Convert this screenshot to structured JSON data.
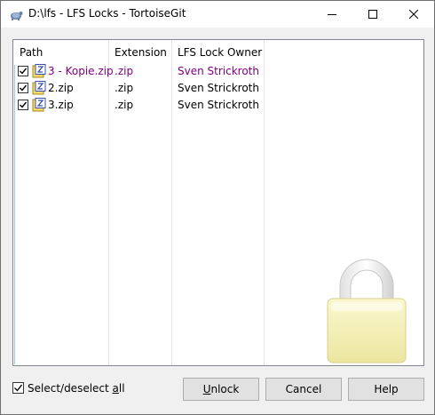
{
  "window": {
    "title": "D:\\lfs - LFS Locks - TortoiseGit",
    "controls": {
      "minimize_icon": "minimize-icon",
      "maximize_icon": "maximize-icon",
      "close_icon": "close-icon"
    }
  },
  "list": {
    "columns": [
      "Path",
      "Extension",
      "LFS Lock Owner"
    ],
    "rows": [
      {
        "checked": true,
        "path": "3 - Kopie.zip",
        "extension": ".zip",
        "owner": "Sven Strickroth",
        "highlight": true
      },
      {
        "checked": true,
        "path": "2.zip",
        "extension": ".zip",
        "owner": "Sven Strickroth",
        "highlight": false
      },
      {
        "checked": true,
        "path": "3.zip",
        "extension": ".zip",
        "owner": "Sven Strickroth",
        "highlight": false
      }
    ],
    "colors": {
      "highlight": "#800080",
      "lock_body": "#f7f3b8"
    }
  },
  "footer": {
    "select_all": {
      "checked": true,
      "label_pre": "Select/deselect ",
      "label_accel": "a",
      "label_post": "ll"
    },
    "buttons": {
      "unlock": {
        "accel": "U",
        "rest": "nlock"
      },
      "cancel": "Cancel",
      "help": "Help"
    }
  }
}
